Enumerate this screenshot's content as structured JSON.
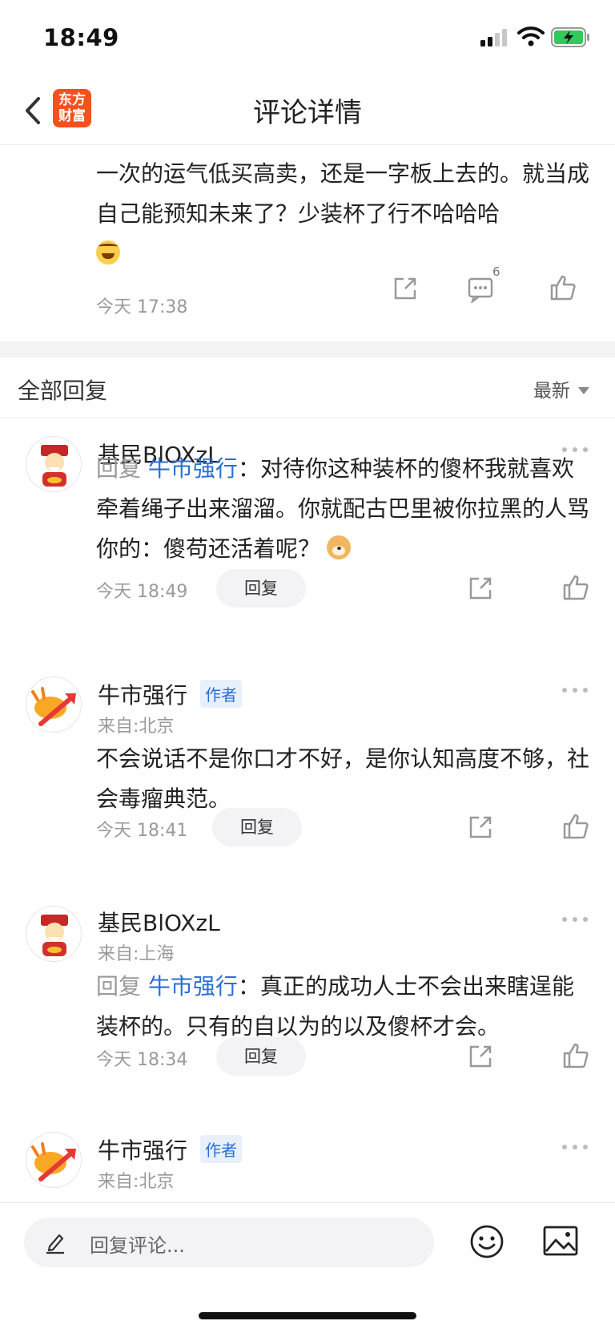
{
  "status_bar": {
    "time": "18:49"
  },
  "header": {
    "title": "评论详情",
    "logo_text": "东方财富"
  },
  "original_comment": {
    "text": "一次的运气低买高卖，还是一字板上去的。就当成自己能预知未来了？少装杯了行不哈哈哈",
    "time": "今天 17:38",
    "comment_count": "6"
  },
  "replies_section": {
    "title": "全部回复",
    "sort": "最新"
  },
  "replies": [
    {
      "username": "基民BlOXzL",
      "prefix": "回复",
      "mention": "牛市强行",
      "separator": "：",
      "text": "对待你这种装杯的傻杯我就喜欢牵着绳子出来溜溜。你就配古巴里被你拉黑的人骂你的：傻苟还活着呢？",
      "time": "今天 18:49",
      "reply_label": "回复"
    },
    {
      "username": "牛市强行",
      "badge": "作者",
      "location": "来自:北京",
      "text": "不会说话不是你口才不好，是你认知高度不够，社会毒瘤典范。",
      "time": "今天 18:41",
      "reply_label": "回复"
    },
    {
      "username": "基民BlOXzL",
      "location": "来自:上海",
      "prefix": "回复",
      "mention": "牛市强行",
      "separator": "：",
      "text": "真正的成功人士不会出来瞎逞能装杯的。只有的自以为的以及傻杯才会。",
      "time": "今天 18:34",
      "reply_label": "回复"
    },
    {
      "username": "牛市强行",
      "badge": "作者",
      "location": "来自:北京"
    }
  ],
  "bottom_bar": {
    "placeholder": "回复评论..."
  },
  "colors": {
    "link": "#2a6fd6",
    "brand": "#f4511e",
    "muted": "#9a9a9a"
  }
}
